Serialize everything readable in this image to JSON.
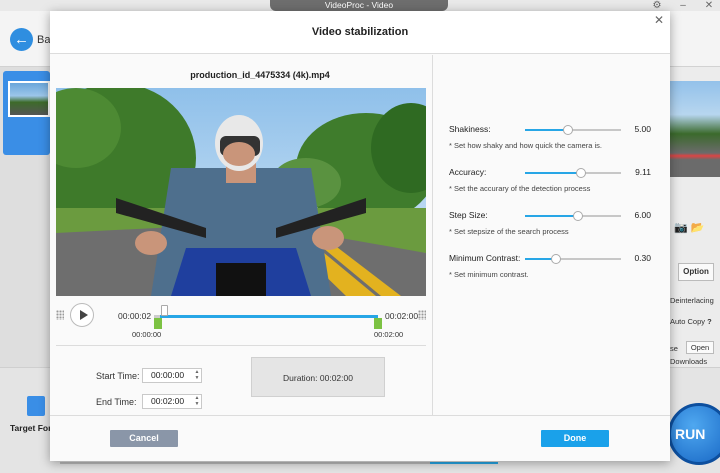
{
  "window": {
    "title": "VideoProc - Video"
  },
  "app": {
    "back_label": "Ba",
    "target_format_label": "Target For",
    "run_label": "RUN",
    "right_panel": {
      "option_label": "Option",
      "deinterlacing_label": "Deinterlacing",
      "auto_copy_label": "Auto Copy",
      "auto_copy_help": "?",
      "browse_label": "se",
      "open_label": "Open",
      "downloads_label": "Downloads"
    }
  },
  "dialog": {
    "title": "Video stabilization",
    "file_name": "production_id_4475334 (4k).mp4",
    "timeline": {
      "current_time": "00:00:02",
      "end_time": "00:02:00",
      "range_start": "00:00:00",
      "range_end": "00:02:00",
      "playhead_fraction": 0.017
    },
    "start_time_label": "Start Time:",
    "start_time_value": "00:00:00",
    "end_time_label": "End Time:",
    "end_time_value": "00:02:00",
    "duration_label": "Duration:",
    "duration_value": "00:02:00",
    "params": [
      {
        "label": "Shakiness:",
        "value": "5.00",
        "fraction": 0.45,
        "hint": "* Set how shaky and how quick the camera is."
      },
      {
        "label": "Accuracy:",
        "value": "9.11",
        "fraction": 0.58,
        "hint": "* Set the accurary of the detection process"
      },
      {
        "label": "Step Size:",
        "value": "6.00",
        "fraction": 0.55,
        "hint": "* Set stepsize of the search process"
      },
      {
        "label": "Minimum Contrast:",
        "value": "0.30",
        "fraction": 0.32,
        "hint": "* Set minimum contrast."
      }
    ],
    "cancel_label": "Cancel",
    "done_label": "Done"
  },
  "colors": {
    "accent": "#1aa1ea",
    "slider_fill": "#27a6e6",
    "trim_handle": "#7cc243",
    "cancel_button": "#8a96a8"
  }
}
